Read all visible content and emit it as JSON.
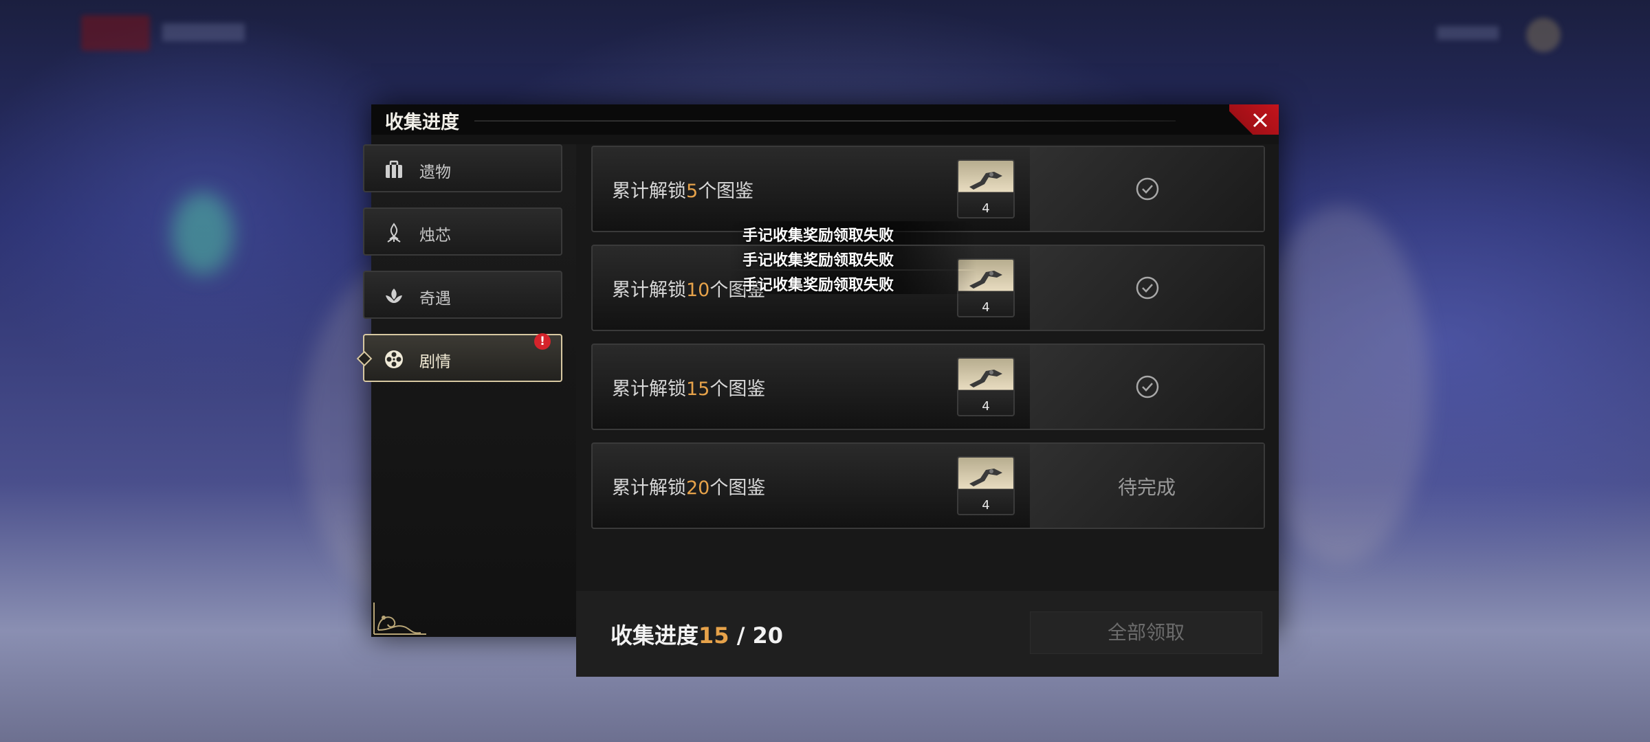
{
  "dialog": {
    "title": "收集进度",
    "accent_color": "#e6a24a",
    "close_color": "#c3141c"
  },
  "sidebar": {
    "tabs": [
      {
        "label": "遗物",
        "icon": "suitcase-icon",
        "active": false
      },
      {
        "label": "烛芯",
        "icon": "candle-flame-icon",
        "active": false
      },
      {
        "label": "奇遇",
        "icon": "lotus-icon",
        "active": false
      },
      {
        "label": "剧情",
        "icon": "film-reel-icon",
        "active": true,
        "badge": "!"
      }
    ]
  },
  "milestones": [
    {
      "prefix": "累计解锁",
      "count": "5",
      "suffix": "个图鉴",
      "reward_qty": "4",
      "status": "claimed"
    },
    {
      "prefix": "累计解锁",
      "count": "10",
      "suffix": "个图鉴",
      "reward_qty": "4",
      "status": "claimed"
    },
    {
      "prefix": "累计解锁",
      "count": "15",
      "suffix": "个图鉴",
      "reward_qty": "4",
      "status": "claimed"
    },
    {
      "prefix": "累计解锁",
      "count": "20",
      "suffix": "个图鉴",
      "reward_qty": "4",
      "status_text": "待完成"
    }
  ],
  "footer": {
    "progress_label": "收集进度",
    "progress_current": "15",
    "progress_total": " / 20",
    "claim_all_label": "全部领取"
  },
  "toasts": [
    "手记收集奖励领取失败",
    "手记收集奖励领取失败",
    "手记收集奖励领取失败"
  ]
}
